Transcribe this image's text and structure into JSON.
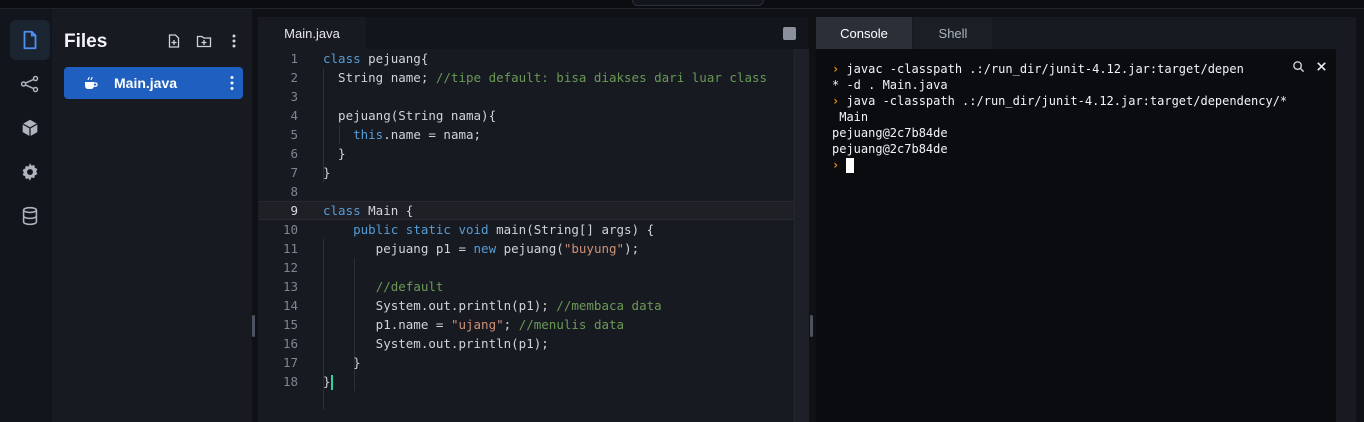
{
  "files_panel": {
    "title": "Files",
    "files": [
      {
        "name": "Main.java",
        "icon": "java-cup-icon",
        "selected": true
      }
    ]
  },
  "editor": {
    "tab_label": "Main.java",
    "current_line": 9,
    "lines": [
      {
        "n": "1",
        "code": [
          {
            "t": "kw",
            "v": "class "
          },
          {
            "t": "tx",
            "v": "pejuang{"
          }
        ]
      },
      {
        "n": "2",
        "code": [
          {
            "t": "tx",
            "v": "  String name; "
          },
          {
            "t": "cm",
            "v": "//tipe default: bisa diakses dari luar class"
          }
        ]
      },
      {
        "n": "3",
        "code": []
      },
      {
        "n": "4",
        "code": [
          {
            "t": "tx",
            "v": "  pejuang(String nama){"
          }
        ]
      },
      {
        "n": "5",
        "code": [
          {
            "t": "tx",
            "v": "    "
          },
          {
            "t": "kw",
            "v": "this"
          },
          {
            "t": "tx",
            "v": ".name = nama;"
          }
        ]
      },
      {
        "n": "6",
        "code": [
          {
            "t": "tx",
            "v": "  }"
          }
        ]
      },
      {
        "n": "7",
        "code": [
          {
            "t": "tx",
            "v": "}"
          }
        ]
      },
      {
        "n": "8",
        "code": []
      },
      {
        "n": "9",
        "code": [
          {
            "t": "kw",
            "v": "class "
          },
          {
            "t": "tx",
            "v": "Main {"
          }
        ]
      },
      {
        "n": "10",
        "code": [
          {
            "t": "tx",
            "v": "    "
          },
          {
            "t": "kw",
            "v": "public static void "
          },
          {
            "t": "tx",
            "v": "main(String[] args) {"
          }
        ]
      },
      {
        "n": "11",
        "code": [
          {
            "t": "tx",
            "v": "       pejuang p1 = "
          },
          {
            "t": "kw",
            "v": "new "
          },
          {
            "t": "tx",
            "v": "pejuang("
          },
          {
            "t": "st",
            "v": "\"buyung\""
          },
          {
            "t": "tx",
            "v": ");"
          }
        ]
      },
      {
        "n": "12",
        "code": []
      },
      {
        "n": "13",
        "code": [
          {
            "t": "tx",
            "v": "       "
          },
          {
            "t": "cm",
            "v": "//default"
          }
        ]
      },
      {
        "n": "14",
        "code": [
          {
            "t": "tx",
            "v": "       System.out.println(p1); "
          },
          {
            "t": "cm",
            "v": "//membaca data"
          }
        ]
      },
      {
        "n": "15",
        "code": [
          {
            "t": "tx",
            "v": "       p1.name = "
          },
          {
            "t": "st",
            "v": "\"ujang\""
          },
          {
            "t": "tx",
            "v": "; "
          },
          {
            "t": "cm",
            "v": "//menulis data"
          }
        ]
      },
      {
        "n": "16",
        "code": [
          {
            "t": "tx",
            "v": "       System.out.println(p1);"
          }
        ]
      },
      {
        "n": "17",
        "code": [
          {
            "t": "tx",
            "v": "    }"
          }
        ]
      },
      {
        "n": "18",
        "code": [
          {
            "t": "tx",
            "v": "}"
          }
        ]
      }
    ]
  },
  "console": {
    "tabs": [
      {
        "label": "Console",
        "active": true
      },
      {
        "label": "Shell",
        "active": false
      }
    ],
    "lines": [
      {
        "prompt": true,
        "text": " javac -classpath .:/run_dir/junit-4.12.jar:target/depen"
      },
      {
        "prompt": false,
        "text": "* -d . Main.java"
      },
      {
        "prompt": true,
        "text": " java -classpath .:/run_dir/junit-4.12.jar:target/dependency/*"
      },
      {
        "prompt": false,
        "text": " Main"
      },
      {
        "prompt": false,
        "text": "pejuang@2c7b84de"
      },
      {
        "prompt": false,
        "text": "pejuang@2c7b84de"
      },
      {
        "prompt": true,
        "text": " ",
        "cursor": true
      }
    ]
  },
  "colors": {
    "accent_blue": "#1f5fbf",
    "prompt_orange": "#f28c28",
    "keyword": "#569cd6",
    "comment": "#6a9955",
    "string": "#ce9178"
  }
}
